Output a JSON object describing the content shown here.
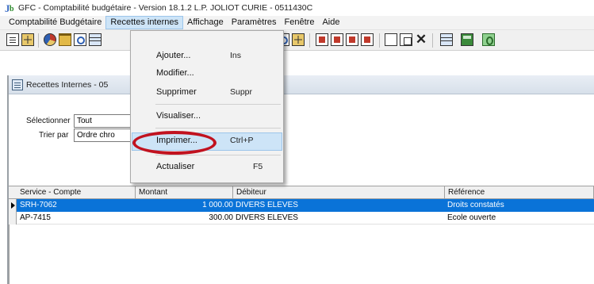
{
  "window": {
    "title": "GFC - Comptabilité budgétaire - Version 18.1.2   L.P. JOLIOT CURIE - 0511430C"
  },
  "menubar": {
    "items": [
      "Comptabilité Budgétaire",
      "Recettes internes",
      "Affichage",
      "Paramètres",
      "Fenêtre",
      "Aide"
    ],
    "active_index": 1
  },
  "dropdown": {
    "items": [
      {
        "label": "Ajouter...",
        "shortcut": "Ins"
      },
      {
        "label": "Modifier...",
        "shortcut": ""
      },
      {
        "label": "Supprimer",
        "shortcut": "Suppr"
      },
      {
        "label": "Visualiser...",
        "shortcut": ""
      },
      {
        "label": "Imprimer...",
        "shortcut": "Ctrl+P"
      },
      {
        "label": "Actualiser",
        "shortcut": "F5"
      }
    ],
    "highlighted_index": 4
  },
  "child_window": {
    "title": "Recettes Internes - 05"
  },
  "filters": {
    "select_label": "Sélectionner",
    "select_value": "Tout",
    "sort_label": "Trier par",
    "sort_value": "Ordre chro"
  },
  "table": {
    "columns": [
      "Service - Compte",
      "Montant",
      "Débiteur",
      "Référence"
    ],
    "rows": [
      {
        "service": "SRH-7062",
        "montant": "1 000.00",
        "debiteur": "DIVERS ELEVES",
        "reference": "Droits constatés",
        "selected": true
      },
      {
        "service": "AP-7415",
        "montant": "300.00",
        "debiteur": "DIVERS ELEVES",
        "reference": "Ecole ouverte",
        "selected": false
      }
    ]
  },
  "colors": {
    "selection": "#0a73d8",
    "menu_highlight": "#cde4f7",
    "annotation_oval": "#c1121f"
  }
}
